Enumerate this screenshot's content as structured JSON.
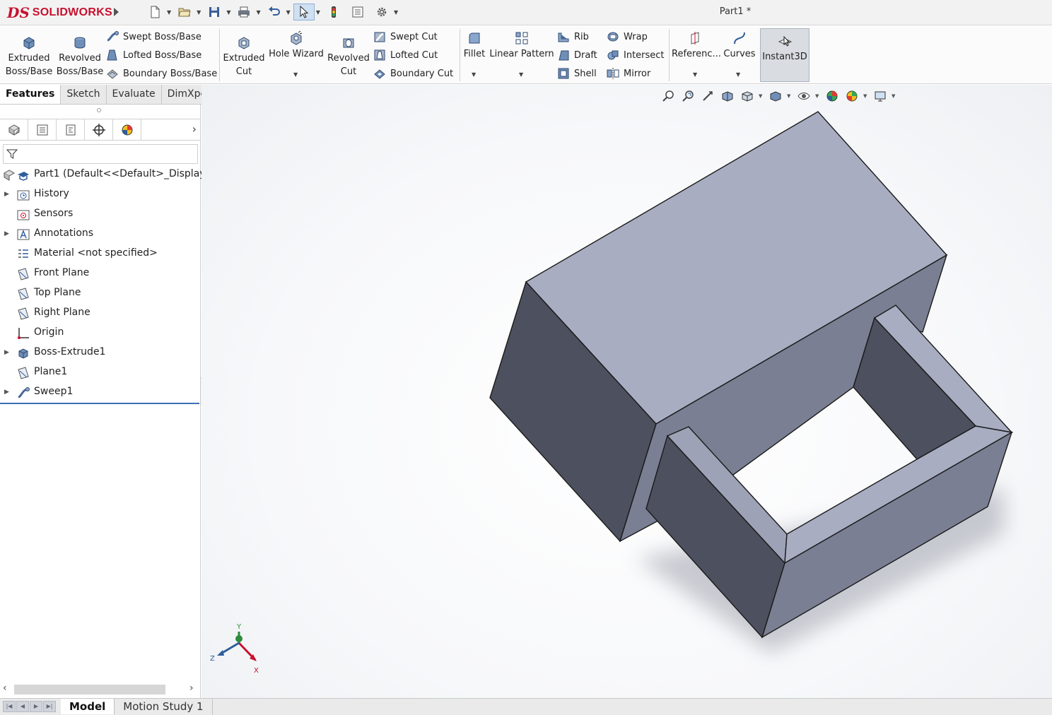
{
  "app": {
    "brand_ds": "DS",
    "brand_name": "SOLIDWORKS",
    "document_title": "Part1 *"
  },
  "quick_access": {
    "icons": [
      "new-document-icon",
      "open-icon",
      "save-icon",
      "print-icon",
      "undo-icon",
      "select-icon",
      "rebuild-icon",
      "file-properties-icon",
      "options-icon"
    ]
  },
  "command_manager": {
    "extruded_boss": [
      "Extruded",
      "Boss/Base"
    ],
    "revolved_boss": [
      "Revolved",
      "Boss/Base"
    ],
    "swept_boss": "Swept Boss/Base",
    "lofted_boss": "Lofted Boss/Base",
    "boundary_boss": "Boundary Boss/Base",
    "extruded_cut": [
      "Extruded",
      "Cut"
    ],
    "hole_wizard": "Hole Wizard",
    "revolved_cut": [
      "Revolved",
      "Cut"
    ],
    "swept_cut": "Swept Cut",
    "lofted_cut": "Lofted Cut",
    "boundary_cut": "Boundary Cut",
    "fillet": "Fillet",
    "linear_pattern": "Linear Pattern",
    "rib": "Rib",
    "draft": "Draft",
    "shell": "Shell",
    "wrap": "Wrap",
    "intersect": "Intersect",
    "mirror": "Mirror",
    "reference": "Referenc...",
    "curves": "Curves",
    "instant3d": "Instant3D"
  },
  "tabs": [
    "Features",
    "Sketch",
    "Evaluate",
    "DimXpert"
  ],
  "active_tab": "Features",
  "feature_tree": {
    "root": "Part1  (Default<<Default>_Display",
    "items": [
      {
        "label": "History",
        "expandable": true,
        "icon": "history-folder-icon"
      },
      {
        "label": "Sensors",
        "expandable": false,
        "icon": "sensors-icon"
      },
      {
        "label": "Annotations",
        "expandable": true,
        "icon": "annotations-icon"
      },
      {
        "label": "Material <not specified>",
        "expandable": false,
        "icon": "material-icon"
      },
      {
        "label": "Front Plane",
        "expandable": false,
        "icon": "plane-icon"
      },
      {
        "label": "Top Plane",
        "expandable": false,
        "icon": "plane-icon"
      },
      {
        "label": "Right Plane",
        "expandable": false,
        "icon": "plane-icon"
      },
      {
        "label": "Origin",
        "expandable": false,
        "icon": "origin-icon"
      },
      {
        "label": "Boss-Extrude1",
        "expandable": true,
        "icon": "extrude-feature-icon"
      },
      {
        "label": "Plane1",
        "expandable": false,
        "icon": "plane-icon"
      },
      {
        "label": "Sweep1",
        "expandable": true,
        "icon": "sweep-feature-icon"
      }
    ]
  },
  "triad": {
    "x": "X",
    "y": "Y",
    "z": "Z"
  },
  "bottom_tabs": [
    "Model",
    "Motion Study 1"
  ],
  "active_bottom_tab": "Model",
  "colors": {
    "brand_red": "#c8102e",
    "face_top": "#a9adc2",
    "face_light": "#9a9eb3",
    "face_mid": "#7b7f93",
    "face_dark": "#4d505e",
    "tree_selection_line": "#3d6fb4"
  }
}
